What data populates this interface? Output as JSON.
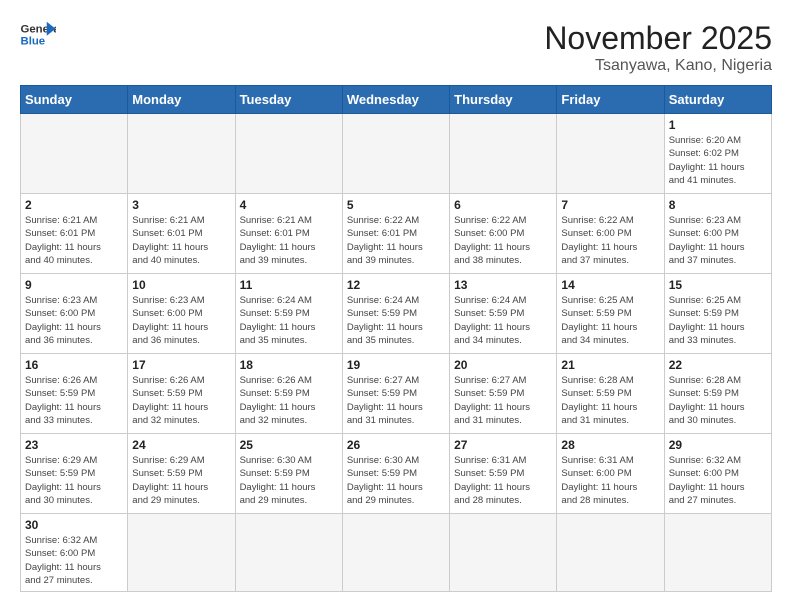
{
  "header": {
    "logo_general": "General",
    "logo_blue": "Blue",
    "title": "November 2025",
    "subtitle": "Tsanyawa, Kano, Nigeria"
  },
  "days": [
    "Sunday",
    "Monday",
    "Tuesday",
    "Wednesday",
    "Thursday",
    "Friday",
    "Saturday"
  ],
  "weeks": [
    [
      {
        "day": "",
        "info": ""
      },
      {
        "day": "",
        "info": ""
      },
      {
        "day": "",
        "info": ""
      },
      {
        "day": "",
        "info": ""
      },
      {
        "day": "",
        "info": ""
      },
      {
        "day": "",
        "info": ""
      },
      {
        "day": "1",
        "info": "Sunrise: 6:20 AM\nSunset: 6:02 PM\nDaylight: 11 hours\nand 41 minutes."
      }
    ],
    [
      {
        "day": "2",
        "info": "Sunrise: 6:21 AM\nSunset: 6:01 PM\nDaylight: 11 hours\nand 40 minutes."
      },
      {
        "day": "3",
        "info": "Sunrise: 6:21 AM\nSunset: 6:01 PM\nDaylight: 11 hours\nand 40 minutes."
      },
      {
        "day": "4",
        "info": "Sunrise: 6:21 AM\nSunset: 6:01 PM\nDaylight: 11 hours\nand 39 minutes."
      },
      {
        "day": "5",
        "info": "Sunrise: 6:22 AM\nSunset: 6:01 PM\nDaylight: 11 hours\nand 39 minutes."
      },
      {
        "day": "6",
        "info": "Sunrise: 6:22 AM\nSunset: 6:00 PM\nDaylight: 11 hours\nand 38 minutes."
      },
      {
        "day": "7",
        "info": "Sunrise: 6:22 AM\nSunset: 6:00 PM\nDaylight: 11 hours\nand 37 minutes."
      },
      {
        "day": "8",
        "info": "Sunrise: 6:23 AM\nSunset: 6:00 PM\nDaylight: 11 hours\nand 37 minutes."
      }
    ],
    [
      {
        "day": "9",
        "info": "Sunrise: 6:23 AM\nSunset: 6:00 PM\nDaylight: 11 hours\nand 36 minutes."
      },
      {
        "day": "10",
        "info": "Sunrise: 6:23 AM\nSunset: 6:00 PM\nDaylight: 11 hours\nand 36 minutes."
      },
      {
        "day": "11",
        "info": "Sunrise: 6:24 AM\nSunset: 5:59 PM\nDaylight: 11 hours\nand 35 minutes."
      },
      {
        "day": "12",
        "info": "Sunrise: 6:24 AM\nSunset: 5:59 PM\nDaylight: 11 hours\nand 35 minutes."
      },
      {
        "day": "13",
        "info": "Sunrise: 6:24 AM\nSunset: 5:59 PM\nDaylight: 11 hours\nand 34 minutes."
      },
      {
        "day": "14",
        "info": "Sunrise: 6:25 AM\nSunset: 5:59 PM\nDaylight: 11 hours\nand 34 minutes."
      },
      {
        "day": "15",
        "info": "Sunrise: 6:25 AM\nSunset: 5:59 PM\nDaylight: 11 hours\nand 33 minutes."
      }
    ],
    [
      {
        "day": "16",
        "info": "Sunrise: 6:26 AM\nSunset: 5:59 PM\nDaylight: 11 hours\nand 33 minutes."
      },
      {
        "day": "17",
        "info": "Sunrise: 6:26 AM\nSunset: 5:59 PM\nDaylight: 11 hours\nand 32 minutes."
      },
      {
        "day": "18",
        "info": "Sunrise: 6:26 AM\nSunset: 5:59 PM\nDaylight: 11 hours\nand 32 minutes."
      },
      {
        "day": "19",
        "info": "Sunrise: 6:27 AM\nSunset: 5:59 PM\nDaylight: 11 hours\nand 31 minutes."
      },
      {
        "day": "20",
        "info": "Sunrise: 6:27 AM\nSunset: 5:59 PM\nDaylight: 11 hours\nand 31 minutes."
      },
      {
        "day": "21",
        "info": "Sunrise: 6:28 AM\nSunset: 5:59 PM\nDaylight: 11 hours\nand 31 minutes."
      },
      {
        "day": "22",
        "info": "Sunrise: 6:28 AM\nSunset: 5:59 PM\nDaylight: 11 hours\nand 30 minutes."
      }
    ],
    [
      {
        "day": "23",
        "info": "Sunrise: 6:29 AM\nSunset: 5:59 PM\nDaylight: 11 hours\nand 30 minutes."
      },
      {
        "day": "24",
        "info": "Sunrise: 6:29 AM\nSunset: 5:59 PM\nDaylight: 11 hours\nand 29 minutes."
      },
      {
        "day": "25",
        "info": "Sunrise: 6:30 AM\nSunset: 5:59 PM\nDaylight: 11 hours\nand 29 minutes."
      },
      {
        "day": "26",
        "info": "Sunrise: 6:30 AM\nSunset: 5:59 PM\nDaylight: 11 hours\nand 29 minutes."
      },
      {
        "day": "27",
        "info": "Sunrise: 6:31 AM\nSunset: 5:59 PM\nDaylight: 11 hours\nand 28 minutes."
      },
      {
        "day": "28",
        "info": "Sunrise: 6:31 AM\nSunset: 6:00 PM\nDaylight: 11 hours\nand 28 minutes."
      },
      {
        "day": "29",
        "info": "Sunrise: 6:32 AM\nSunset: 6:00 PM\nDaylight: 11 hours\nand 27 minutes."
      }
    ],
    [
      {
        "day": "30",
        "info": "Sunrise: 6:32 AM\nSunset: 6:00 PM\nDaylight: 11 hours\nand 27 minutes."
      },
      {
        "day": "",
        "info": ""
      },
      {
        "day": "",
        "info": ""
      },
      {
        "day": "",
        "info": ""
      },
      {
        "day": "",
        "info": ""
      },
      {
        "day": "",
        "info": ""
      },
      {
        "day": "",
        "info": ""
      }
    ]
  ]
}
